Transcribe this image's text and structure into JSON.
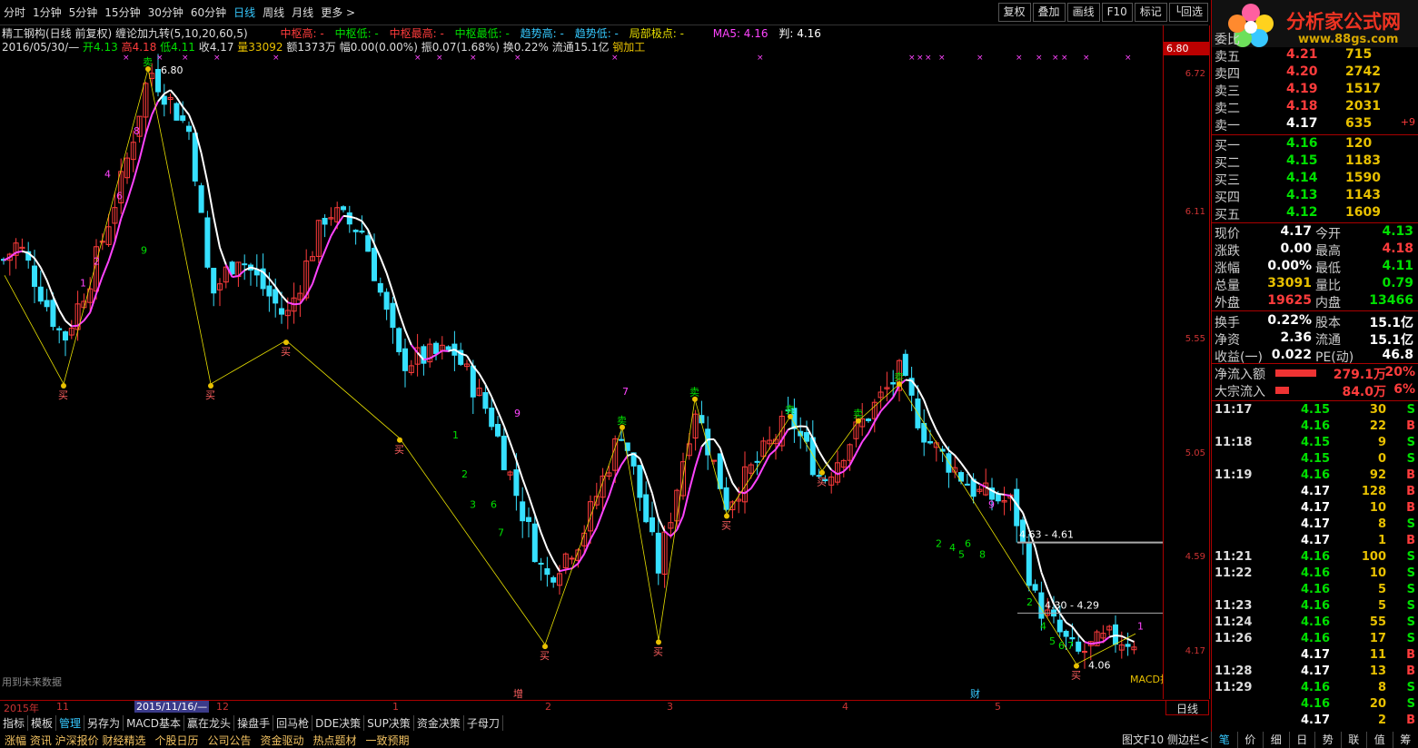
{
  "periods": [
    "分时",
    "1分钟",
    "5分钟",
    "15分钟",
    "30分钟",
    "60分钟",
    "日线",
    "周线",
    "月线",
    "更多 >"
  ],
  "active_period": "日线",
  "toolbar_right": [
    "复权",
    "叠加",
    "画线",
    "F10",
    "标记",
    "└回选"
  ],
  "info1": {
    "name": "精工钢构(日线 前复权) 缠论加九转(5,10,20,60,5)",
    "zs_high": "中枢高: -",
    "zs_low": "中枢低: -",
    "zs_max": "中枢最高: -",
    "zs_min": "中枢最低: -",
    "trend_high": "趋势高: -",
    "trend_low": "趋势低: -",
    "local": "局部极点: -",
    "ma5": "MA5: 4.16",
    "judge": "判: 4.16"
  },
  "info2": {
    "date": "2016/05/30/—",
    "open": "开4.13",
    "high": "高4.18",
    "low": "低4.11",
    "close": "收4.17",
    "vol": "量33092",
    "amt": "额1373万",
    "fu": "幅0.00(0.00%)",
    "zhen": "振0.07(1.68%)",
    "huan": "换0.22%",
    "ltv": "流通15.1亿",
    "ind": "钢加工"
  },
  "price_ticks": [
    "6.72",
    "6.11",
    "5.55",
    "5.05",
    "4.59",
    "4.17"
  ],
  "price_highlight": "6.80",
  "chart_labels": {
    "peak": "6.80",
    "zone1": "4.63 - 4.61",
    "zone2": "4.30 - 4.29",
    "low": "4.06",
    "future": "用到未来数据",
    "macd": "MACD指",
    "zeng": "增",
    "cai": "财"
  },
  "date_axis": [
    "2015年",
    "11",
    "2015/11/16/—",
    "12",
    "1",
    "2",
    "3",
    "4",
    "5"
  ],
  "day_label": "日线",
  "bottom_tabs": [
    "指标",
    "模板",
    "管理",
    "另存为",
    "MACD基本",
    "赢在龙头",
    "操盘手",
    "回马枪",
    "DDE决策",
    "SUP决策",
    "资金决策",
    "子母刀"
  ],
  "bottom_tab_selected": "管理",
  "bottom_tabs2": [
    "涨幅 资讯 沪深报价 财经精选",
    "个股日历",
    "公司公告",
    "资金驱动",
    "热点题材",
    "一致预期"
  ],
  "side_btn": "图文F10 侧边栏<",
  "right_tabs": [
    "笔",
    "价",
    "细",
    "日",
    "势",
    "联",
    "值",
    "筹"
  ],
  "logo": {
    "title": "分析家公式网",
    "url": "www.88gs.com"
  },
  "orderbook": {
    "header": "委比",
    "sell": [
      {
        "l": "卖五",
        "p": "4.21",
        "v": "715"
      },
      {
        "l": "卖四",
        "p": "4.20",
        "v": "2742"
      },
      {
        "l": "卖三",
        "p": "4.19",
        "v": "1517"
      },
      {
        "l": "卖二",
        "p": "4.18",
        "v": "2031"
      },
      {
        "l": "卖一",
        "p": "4.17",
        "v": "635",
        "d": "+9"
      }
    ],
    "buy": [
      {
        "l": "买一",
        "p": "4.16",
        "v": "120"
      },
      {
        "l": "买二",
        "p": "4.15",
        "v": "1183"
      },
      {
        "l": "买三",
        "p": "4.14",
        "v": "1590"
      },
      {
        "l": "买四",
        "p": "4.13",
        "v": "1143"
      },
      {
        "l": "买五",
        "p": "4.12",
        "v": "1609"
      }
    ]
  },
  "stats": [
    {
      "l": "现价",
      "v": "4.17",
      "l2": "今开",
      "v2": "4.13"
    },
    {
      "l": "涨跌",
      "v": "0.00",
      "l2": "最高",
      "v2": "4.18"
    },
    {
      "l": "涨幅",
      "v": "0.00%",
      "l2": "最低",
      "v2": "4.11"
    },
    {
      "l": "总量",
      "v": "33091",
      "l2": "量比",
      "v2": "0.79"
    },
    {
      "l": "外盘",
      "v": "19625",
      "l2": "内盘",
      "v2": "13466"
    },
    {
      "l": "换手",
      "v": "0.22%",
      "l2": "股本",
      "v2": "15.1亿"
    },
    {
      "l": "净资",
      "v": "2.36",
      "l2": "流通",
      "v2": "15.1亿"
    },
    {
      "l": "收益(一)",
      "v": "0.022",
      "l2": "PE(动)",
      "v2": "46.8"
    }
  ],
  "flow": [
    {
      "l": "净流入额",
      "v": "279.1万",
      "p": "20%",
      "bar": 0.86
    },
    {
      "l": "大宗流入",
      "v": "84.0万",
      "p": "6%",
      "bar": 0.28
    }
  ],
  "ticks": [
    {
      "t": "11:17",
      "p": "4.15",
      "v": "30",
      "s": "S"
    },
    {
      "t": "",
      "p": "4.16",
      "v": "22",
      "s": "B"
    },
    {
      "t": "11:18",
      "p": "4.15",
      "v": "9",
      "s": "S"
    },
    {
      "t": "",
      "p": "4.15",
      "v": "0",
      "s": "S"
    },
    {
      "t": "11:19",
      "p": "4.16",
      "v": "92",
      "s": "B"
    },
    {
      "t": "",
      "p": "4.17",
      "v": "128",
      "s": "B"
    },
    {
      "t": "",
      "p": "4.17",
      "v": "10",
      "s": "B"
    },
    {
      "t": "",
      "p": "4.17",
      "v": "8",
      "s": "S"
    },
    {
      "t": "",
      "p": "4.17",
      "v": "1",
      "s": "B"
    },
    {
      "t": "11:21",
      "p": "4.16",
      "v": "100",
      "s": "S"
    },
    {
      "t": "11:22",
      "p": "4.16",
      "v": "10",
      "s": "S"
    },
    {
      "t": "",
      "p": "4.16",
      "v": "5",
      "s": "S"
    },
    {
      "t": "11:23",
      "p": "4.16",
      "v": "5",
      "s": "S"
    },
    {
      "t": "11:24",
      "p": "4.16",
      "v": "55",
      "s": "S"
    },
    {
      "t": "11:26",
      "p": "4.16",
      "v": "17",
      "s": "S"
    },
    {
      "t": "",
      "p": "4.17",
      "v": "11",
      "s": "B"
    },
    {
      "t": "11:28",
      "p": "4.17",
      "v": "13",
      "s": "B"
    },
    {
      "t": "11:29",
      "p": "4.16",
      "v": "8",
      "s": "S"
    },
    {
      "t": "",
      "p": "4.16",
      "v": "20",
      "s": "S"
    },
    {
      "t": "",
      "p": "4.17",
      "v": "2",
      "s": "B"
    }
  ],
  "colors": {
    "up": "#ff3c3c",
    "down": "#36e0ff",
    "ma": "#ff44ff",
    "white": "#ffffff",
    "zig": "#e8e000",
    "green": "#00e000",
    "yellow": "#e8c000"
  }
}
